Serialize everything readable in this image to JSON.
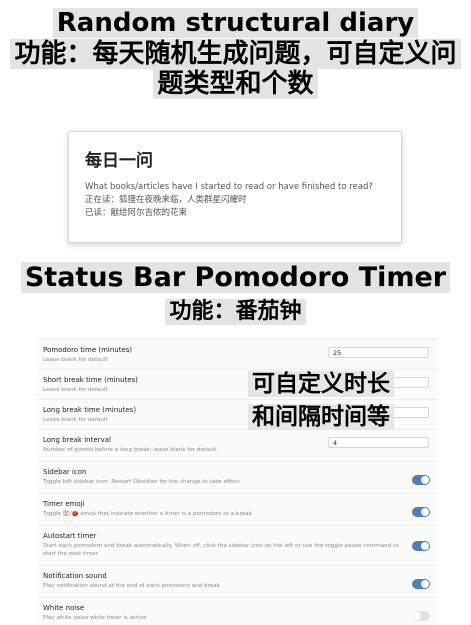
{
  "banner1": {
    "title": "Random structural diary",
    "subtitle": "功能：每天随机生成问题，可自定义问题类型和个数"
  },
  "diary_card": {
    "heading": "每日一问",
    "question": "What books/articles have I started to read or have finished to read?",
    "reading": "正在读：狐狸在夜晚来临，人类群星闪耀时",
    "finished": "已读：献给阿尔吉侬的花束"
  },
  "banner2": {
    "title": "Status Bar Pomodoro Timer",
    "subtitle": "功能：番茄钟"
  },
  "overlay": {
    "line1": "可自定义时长",
    "line2": "和间隔时间等"
  },
  "settings": {
    "pomodoro_time": {
      "name": "Pomodoro time (minutes)",
      "desc": "Leave blank for default",
      "value": "25"
    },
    "short_break": {
      "name": "Short break time (minutes)",
      "desc": "Leave blank for default",
      "value": ""
    },
    "long_break": {
      "name": "Long break time (minutes)",
      "desc": "Leave blank for default",
      "value": ""
    },
    "long_break_interval": {
      "name": "Long break interval",
      "desc": "Number of pomos before a long break; leave blank for default",
      "value": "4"
    },
    "sidebar_icon": {
      "name": "Sidebar icon",
      "desc": "Toggle left sidebar icon. Restart Obsidian for the change to take effect",
      "enabled": true
    },
    "timer_emoji": {
      "name": "Timer emoji",
      "desc": "Toggle 🏖️/🍅 emoji that indicate whether a timer is a pomodoro or a break.",
      "enabled": true
    },
    "autostart_timer": {
      "name": "Autostart timer",
      "desc": "Start each pomodoro and break automatically. When off, click the sidebar icon on the left or use the toggle pause command to start the next timer",
      "enabled": true
    },
    "notification_sound": {
      "name": "Notification sound",
      "desc": "Play notification sound at the end of each pomodoro and break",
      "enabled": true
    },
    "white_noise": {
      "name": "White noise",
      "desc": "Play white noise while timer is active",
      "enabled": false
    }
  },
  "colors": {
    "toggle_on": "#4a7fc1",
    "toggle_off": "#e2e2e2",
    "banner_band": "#e3e3e3"
  }
}
